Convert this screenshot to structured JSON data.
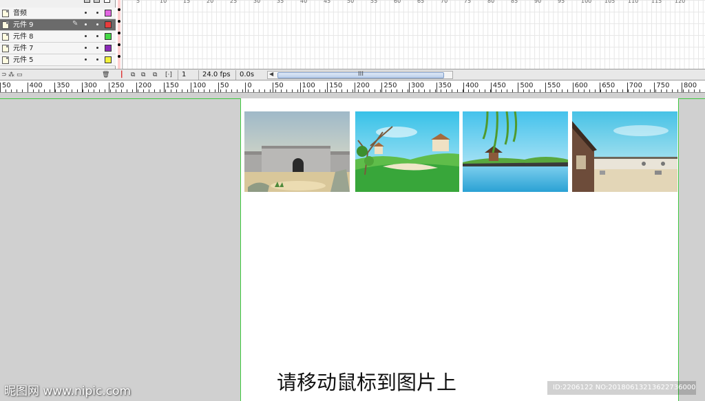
{
  "timeline": {
    "layers": [
      {
        "name": "音频",
        "color": "#e266e2",
        "selected": false
      },
      {
        "name": "元件 9",
        "color": "#e83c3c",
        "selected": true
      },
      {
        "name": "元件 8",
        "color": "#45d845",
        "selected": false
      },
      {
        "name": "元件 7",
        "color": "#8c2ab8",
        "selected": false
      },
      {
        "name": "元件 5",
        "color": "#f2f23c",
        "selected": false
      }
    ],
    "frame_ruler": [
      "5",
      "10",
      "15",
      "20",
      "25",
      "30",
      "35",
      "40",
      "45",
      "50",
      "55",
      "60",
      "65",
      "70",
      "75",
      "80",
      "85",
      "90",
      "95",
      "100",
      "105",
      "110",
      "115",
      "120"
    ],
    "current_frame": "1",
    "frame_rate": "24.0 fps",
    "elapsed_time": "0.0s",
    "scroll_grip": "III"
  },
  "stage_ruler": {
    "labels": [
      "50",
      "400",
      "350",
      "300",
      "250",
      "200",
      "150",
      "100",
      "50",
      "0",
      "50",
      "100",
      "150",
      "200",
      "250",
      "300",
      "350",
      "400",
      "450",
      "500",
      "550",
      "600",
      "650",
      "700",
      "750",
      "800"
    ]
  },
  "stage": {
    "prompt": "请移动鼠标到图片上",
    "scenes": [
      "city-wall-scene",
      "village-hill-scene",
      "lake-pavilion-scene",
      "courtyard-scene"
    ]
  },
  "watermark": {
    "logo": "昵图网 www.nipic.com",
    "id": "ID:2206122 NO:20180613213622736000"
  }
}
